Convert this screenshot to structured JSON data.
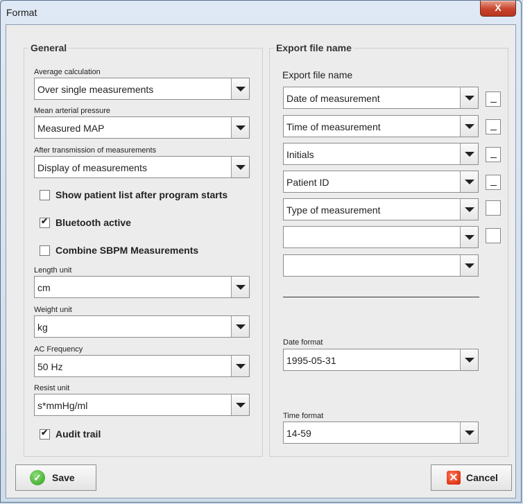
{
  "window": {
    "title": "Format",
    "close_glyph": "X"
  },
  "general": {
    "legend": "General",
    "average": {
      "label": "Average calculation",
      "value": "Over single measurements"
    },
    "map": {
      "label": "Mean arterial pressure",
      "value": "Measured MAP"
    },
    "after": {
      "label": "After transmission of measurements",
      "value": "Display of measurements"
    },
    "checks": {
      "patient_list": {
        "label": "Show patient list after program starts",
        "checked": false
      },
      "bluetooth": {
        "label": "Bluetooth active",
        "checked": true
      },
      "combine": {
        "label": "Combine SBPM Measurements",
        "checked": false
      }
    },
    "length": {
      "label": "Length unit",
      "value": "cm"
    },
    "weight": {
      "label": "Weight unit",
      "value": "kg"
    },
    "ac": {
      "label": "AC Frequency",
      "value": "50 Hz"
    },
    "resist": {
      "label": "Resist unit",
      "value": "s*mmHg/ml"
    },
    "audit": {
      "label": "Audit trail",
      "checked": true
    }
  },
  "export": {
    "legend": "Export file name",
    "heading": "Export file name",
    "fields": [
      {
        "value": "Date of measurement",
        "separator": "_"
      },
      {
        "value": "Time of measurement",
        "separator": "_"
      },
      {
        "value": "Initials",
        "separator": "_"
      },
      {
        "value": "Patient ID",
        "separator": "_"
      },
      {
        "value": "Type of measurement",
        "separator": ""
      },
      {
        "value": "",
        "separator": ""
      },
      {
        "value": ""
      }
    ],
    "date_format": {
      "label": "Date format",
      "value": "1995-05-31"
    },
    "time_format": {
      "label": "Time format",
      "value": "14-59"
    }
  },
  "buttons": {
    "save": "Save",
    "cancel": "Cancel"
  }
}
